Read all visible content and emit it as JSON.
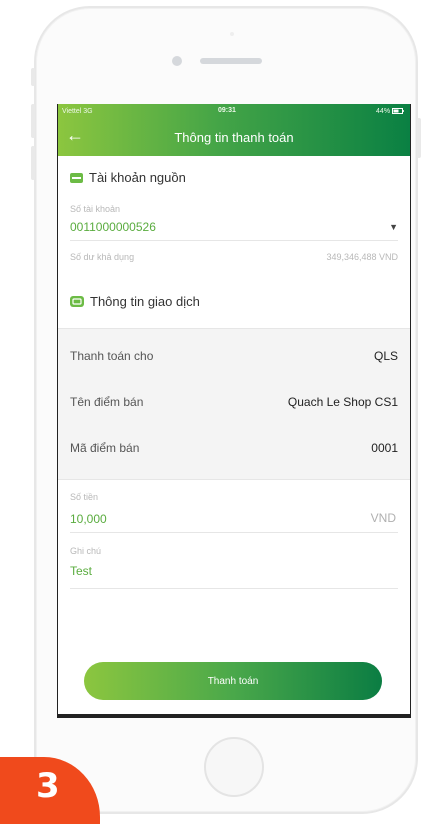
{
  "status_bar": {
    "carrier": "Viettel 3G",
    "time": "09:31",
    "battery": "44%"
  },
  "app_bar": {
    "title": "Thông tin thanh toán",
    "back_icon": "arrow-left-icon"
  },
  "source_account": {
    "header": "Tài khoản nguồn",
    "icon": "wallet-icon",
    "account_label": "Số tài khoản",
    "account_number": "0011000000526",
    "balance_label": "Số dư khả dụng",
    "balance_value": "349,346,488 VND"
  },
  "transaction_info": {
    "header": "Thông tin giao dịch",
    "icon": "transaction-icon",
    "rows": [
      {
        "label": "Thanh toán cho",
        "value": "QLS"
      },
      {
        "label": "Tên điểm bán",
        "value": "Quach Le Shop CS1"
      },
      {
        "label": "Mã điểm bán",
        "value": "0001"
      }
    ]
  },
  "amount": {
    "label": "Số tiền",
    "value": "10,000",
    "unit": "VND"
  },
  "note": {
    "label": "Ghi chú",
    "value": "Test"
  },
  "pay_button": {
    "label": "Thanh toán"
  },
  "step_badge": {
    "number": "3"
  },
  "colors": {
    "brand_light": "#8cc63f",
    "brand_dark": "#0a8043",
    "badge": "#f04a1c"
  }
}
